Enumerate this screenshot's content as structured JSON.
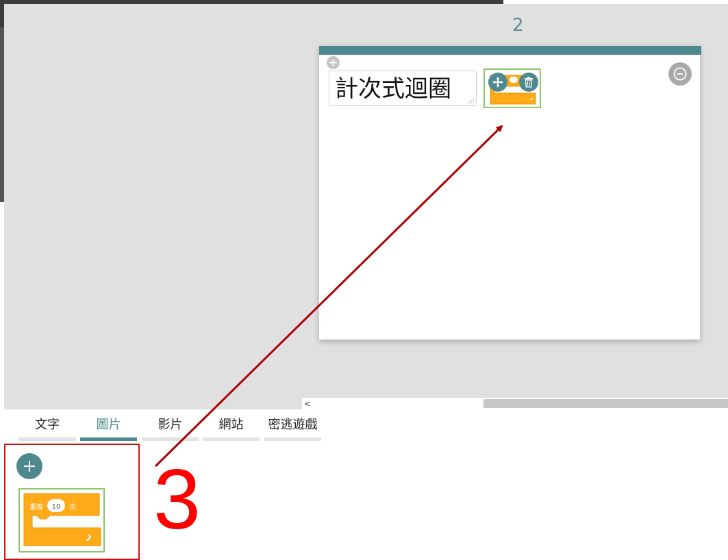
{
  "slide": {
    "page_number": "2",
    "text_box_value": "計次式迴圈"
  },
  "block": {
    "repeat_label": "重複",
    "repeat_count": "10",
    "repeat_unit": "次"
  },
  "tabs": [
    {
      "label": "文字",
      "active": false
    },
    {
      "label": "圖片",
      "active": true
    },
    {
      "label": "影片",
      "active": false
    },
    {
      "label": "網站",
      "active": false
    },
    {
      "label": "密逃遊戲",
      "active": false
    }
  ],
  "scrollbar": {
    "left_arrow": "<"
  },
  "annotation": {
    "step": "3",
    "color": "#ff0000",
    "arrow_color": "#b00000"
  },
  "colors": {
    "accent": "#4f8990",
    "block_orange": "#ffab19",
    "selected_green": "#8cc56a"
  },
  "icons": [
    "move-icon",
    "trash-icon",
    "zoom-out-icon",
    "plus-icon",
    "resize-grip-icon"
  ]
}
